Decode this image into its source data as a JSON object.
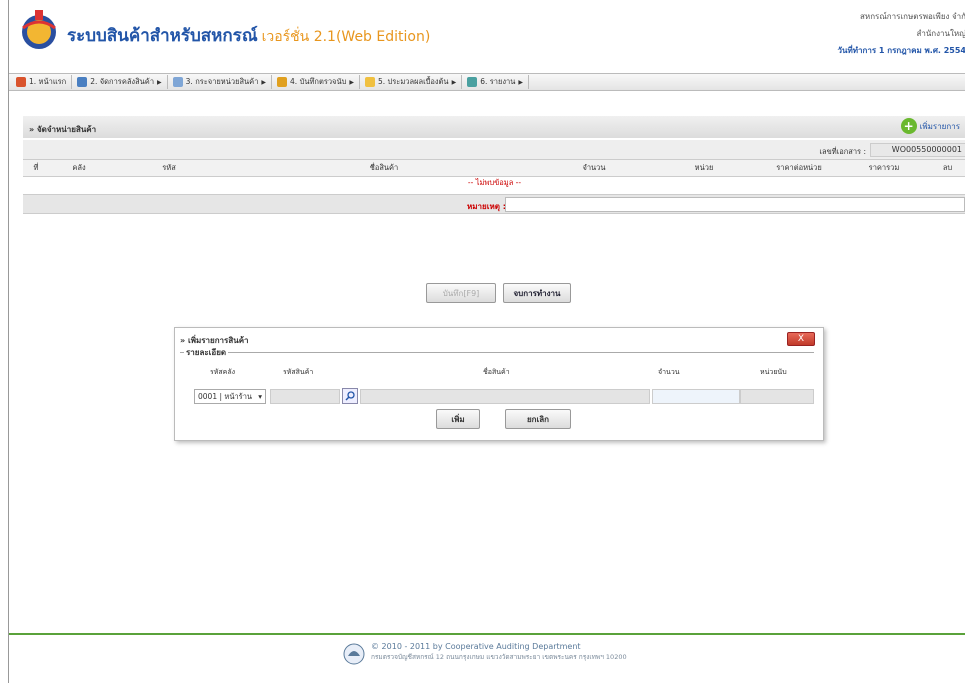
{
  "header": {
    "title": "ระบบสินค้าสำหรับสหกรณ์",
    "version": "เวอร์ชั่น 2.1(Web Edition)",
    "org_name": "สหกรณ์การเกษตรพอเพียง จำกั",
    "org_branch": "สำนักงานใหญ่",
    "work_date": "วันที่ทำการ 1 กรกฎาคม พ.ศ. 2554"
  },
  "menu": {
    "items": [
      {
        "label": "1. หน้าแรก",
        "color": "#d9532c"
      },
      {
        "label": "2. จัดการคลังสินค้า",
        "color": "#4a7fc1"
      },
      {
        "label": "3. กระจายหน่วยสินค้า",
        "color": "#7fa6d6"
      },
      {
        "label": "4. บันทึกตรวจนับ",
        "color": "#e0a020"
      },
      {
        "label": "5. ประมวลผลเบื้องต้น",
        "color": "#f0c040"
      },
      {
        "label": "6. รายงาน",
        "color": "#4aa0a0"
      }
    ]
  },
  "panel": {
    "title": "» จัดจำหน่ายสินค้า",
    "add_label": "เพิ่มรายการ",
    "doc_no_label": "เลขที่เอกสาร :",
    "doc_no_value": "WO00550000001",
    "columns": [
      "ที่",
      "คลัง",
      "รหัส",
      "ชื่อสินค้า",
      "จำนวน",
      "หน่วย",
      "ราคาต่อหน่วย",
      "ราคารวม",
      "ลบ"
    ],
    "empty_text": "-- ไม่พบข้อมูล --",
    "remark_label": "หมายเหตุ :"
  },
  "actions": {
    "save_label": "บันทึก[F9]",
    "end_label": "จบการทำงาน"
  },
  "dialog": {
    "title": "» เพิ่มรายการสินค้า",
    "close_label": "X",
    "legend": "รายละเอียด",
    "col_warehouse": "รหัสคลัง",
    "col_code": "รหัสสินค้า",
    "col_name": "ชื่อสินค้า",
    "col_qty": "จำนวน",
    "col_unit": "หน่วยนับ",
    "warehouse_value": "0001 | หน้าร้าน",
    "add_label": "เพิ่ม",
    "cancel_label": "ยกเลิก"
  },
  "footer": {
    "copyright": "© 2010 - 2011  by Cooperative Auditing Department",
    "address": "กรมตรวจบัญชีสหกรณ์ 12 ถนนกรุงเกษม แขวงวัดสามพระยา เขตพระนคร กรุงเทพฯ 10200"
  }
}
